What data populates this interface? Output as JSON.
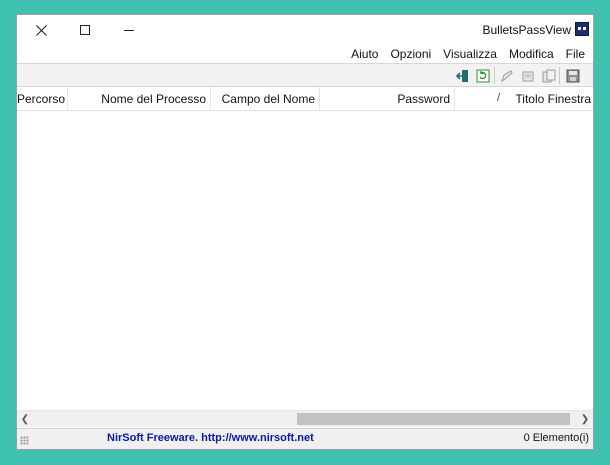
{
  "window": {
    "title": "BulletsPassView",
    "menu": [
      "File",
      "Modifica",
      "Visualizza",
      "Opzioni",
      "Aiuto"
    ]
  },
  "toolbar": {
    "buttons": [
      "save-icon",
      "copy-icon",
      "properties-icon",
      "report-icon",
      "refresh-icon",
      "exit-icon"
    ]
  },
  "list": {
    "columns": [
      "Titolo Finestra",
      "Password",
      "Campo del Nome",
      "Nome del Processo",
      "Percorso d"
    ],
    "sort_indicator": "/",
    "rows": []
  },
  "statusbar": {
    "count": "0 Elemento(i)",
    "link": "NirSoft Freeware.  http://www.nirsoft.net"
  }
}
